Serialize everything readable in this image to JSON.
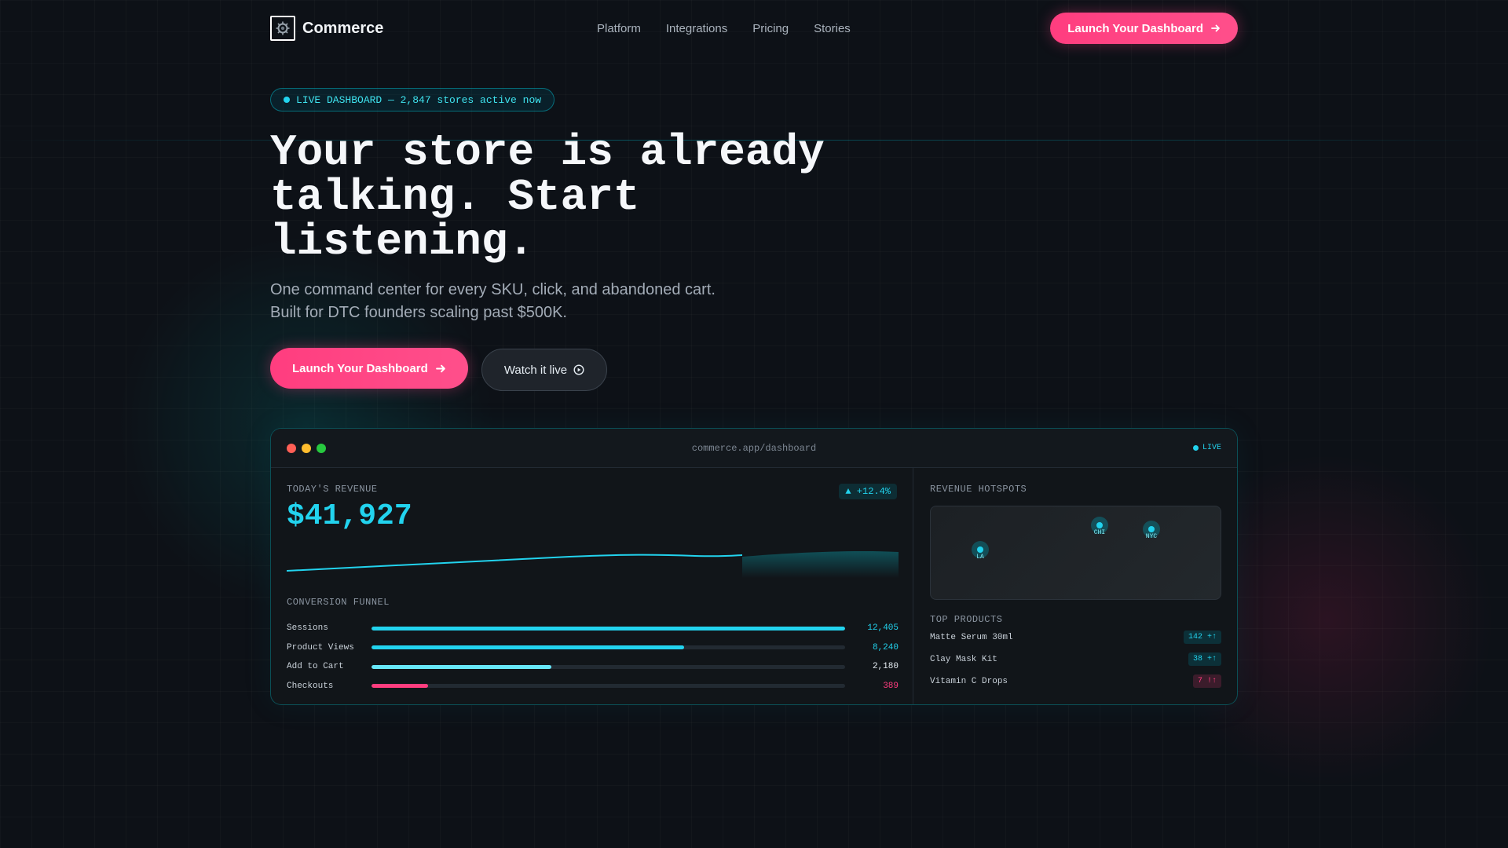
{
  "colors": {
    "accent_pink": "#ff3d7f",
    "accent_cyan": "#22d3ee",
    "background": "#0d1117"
  },
  "nav": {
    "brand": "Commerce",
    "links": [
      "Platform",
      "Integrations",
      "Pricing",
      "Stories"
    ],
    "cta_label": "Launch Your Dashboard",
    "cta_icon": "arrow-right-icon"
  },
  "hero": {
    "live_pill": "LIVE DASHBOARD — 2,847 stores active now",
    "headline_lines": [
      "Your store is already",
      "talking. Start",
      "listening."
    ],
    "subtitle_lines": [
      "One command center for every SKU, click, and abandoned cart.",
      "Built for DTC founders scaling past $500K."
    ],
    "primary_label": "Launch Your Dashboard",
    "secondary_label": "Watch it live",
    "secondary_icon": "play-circle-icon"
  },
  "dashboard": {
    "url": "commerce.app/dashboard",
    "live_label": "LIVE",
    "revenue": {
      "label": "TODAY'S REVENUE",
      "value": "$41,927",
      "delta": "▲ +12.4%"
    },
    "funnel": {
      "title": "CONVERSION FUNNEL",
      "rows": [
        {
          "label": "Sessions",
          "value": "12,405",
          "fraction": 1.0,
          "color": "#22d3ee",
          "value_color": "#22d3ee"
        },
        {
          "label": "Product Views",
          "value": "8,240",
          "fraction": 0.66,
          "color": "#22d3ee",
          "value_color": "#22d3ee"
        },
        {
          "label": "Add to Cart",
          "value": "2,180",
          "fraction": 0.38,
          "color": "#67e8f9",
          "value_color": "#e6edf3"
        },
        {
          "label": "Checkouts",
          "value": "389",
          "fraction": 0.12,
          "color": "#ff3d7f",
          "value_color": "#ff3d7f"
        }
      ]
    },
    "hotspots": {
      "title": "REVENUE HOTSPOTS",
      "cities": [
        "LA",
        "CHI",
        "NYC"
      ]
    },
    "top_products": {
      "title": "TOP PRODUCTS",
      "items": [
        {
          "name": "Matte Serum 30ml",
          "badge": "142 +↑",
          "tone": "cyan"
        },
        {
          "name": "Clay Mask Kit",
          "badge": "38 +↑",
          "tone": "cyan"
        },
        {
          "name": "Vitamin C Drops",
          "badge": "7 !↑",
          "tone": "pink"
        }
      ]
    }
  }
}
